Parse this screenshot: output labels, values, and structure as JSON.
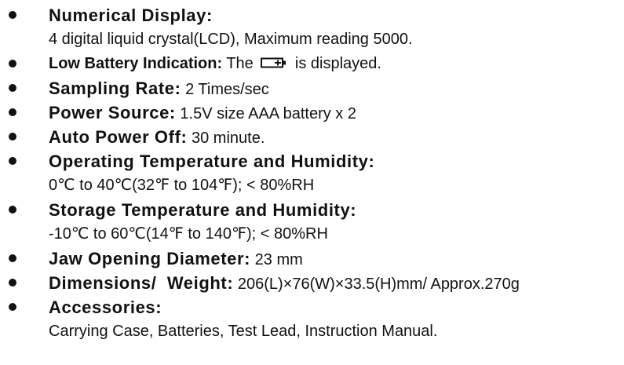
{
  "specs": [
    {
      "label": "Numerical Display:",
      "value": "",
      "detail": "4 digital liquid crystal(LCD), Maximum reading 5000."
    },
    {
      "label": "Low Battery Indication:",
      "value_before": " The ",
      "icon": "battery-icon",
      "value_after": " is displayed."
    },
    {
      "label": "Sampling Rate:",
      "value": " 2 Times/sec"
    },
    {
      "label": "Power Source:",
      "value": " 1.5V size AAA battery x 2"
    },
    {
      "label": "Auto Power Off:",
      "value": " 30 minute."
    },
    {
      "label": "Operating Temperature and Humidity:",
      "value": "",
      "detail": "0℃ to 40℃(32℉ to 104℉); < 80%RH"
    },
    {
      "label": "Storage Temperature and Humidity:",
      "value": "",
      "detail": "-10℃ to 60℃(14℉ to 140℉); < 80%RH"
    },
    {
      "label": "Jaw Opening Diameter:",
      "value": " 23 mm"
    },
    {
      "label": "Dimensions/  Weight:",
      "value": " 206(L)×76(W)×33.5(H)mm/ Approx.270g"
    },
    {
      "label": "Accessories:",
      "value": "",
      "detail": "Carrying Case, Batteries, Test Lead, Instruction Manual."
    }
  ]
}
